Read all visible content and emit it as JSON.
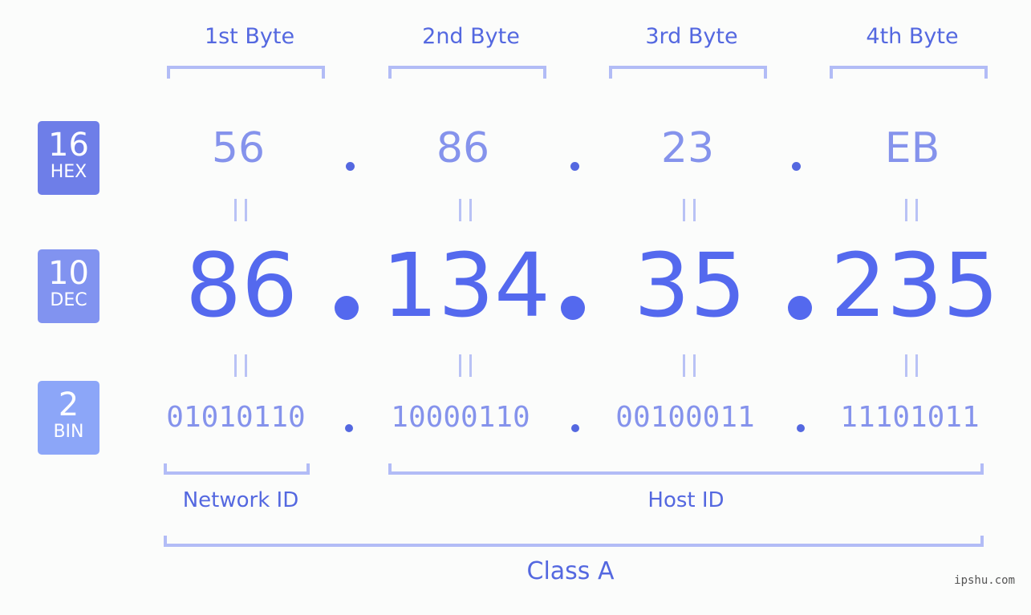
{
  "colors": {
    "accent": "#5468e0",
    "hex_badge": "#6e7ee8",
    "dec_badge": "#8193f0",
    "bin_badge": "#8ca6f8",
    "bracket": "#b2bcf6",
    "light_value": "#8593ec"
  },
  "byte_headers": [
    "1st Byte",
    "2nd Byte",
    "3rd Byte",
    "4th Byte"
  ],
  "badges": {
    "hex": {
      "base": "16",
      "label": "HEX"
    },
    "dec": {
      "base": "10",
      "label": "DEC"
    },
    "bin": {
      "base": "2",
      "label": "BIN"
    }
  },
  "hex_values": [
    "56",
    "86",
    "23",
    "EB"
  ],
  "dec_values": [
    "86",
    "134",
    "35",
    "235"
  ],
  "bin_values": [
    "01010110",
    "10000110",
    "00100011",
    "11101011"
  ],
  "groups": {
    "network_id": "Network ID",
    "host_id": "Host ID",
    "class": "Class A"
  },
  "watermark": "ipshu.com"
}
